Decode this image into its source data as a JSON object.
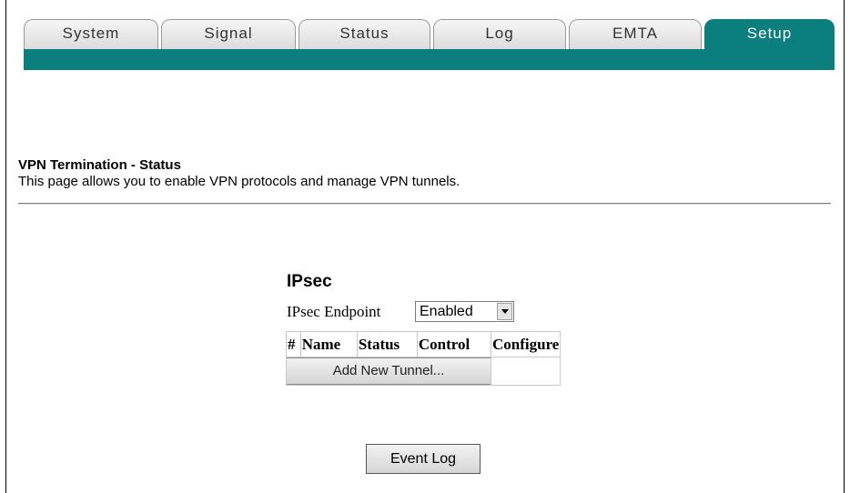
{
  "tabs": [
    {
      "label": "System"
    },
    {
      "label": "Signal"
    },
    {
      "label": "Status"
    },
    {
      "label": "Log"
    },
    {
      "label": "EMTA"
    },
    {
      "label": "Setup"
    }
  ],
  "active_tab": "Setup",
  "page": {
    "title": "VPN Termination - Status",
    "description": "This page allows you to enable VPN protocols and manage VPN tunnels."
  },
  "ipsec": {
    "title": "IPsec",
    "endpoint_label": "IPsec Endpoint",
    "endpoint_value": "Enabled",
    "table_headers": [
      "#",
      "Name",
      "Status",
      "Control",
      "Configure"
    ],
    "add_tunnel_label": "Add New Tunnel..."
  },
  "event_log_label": "Event Log",
  "colors": {
    "accent": "#0b7e7e"
  }
}
